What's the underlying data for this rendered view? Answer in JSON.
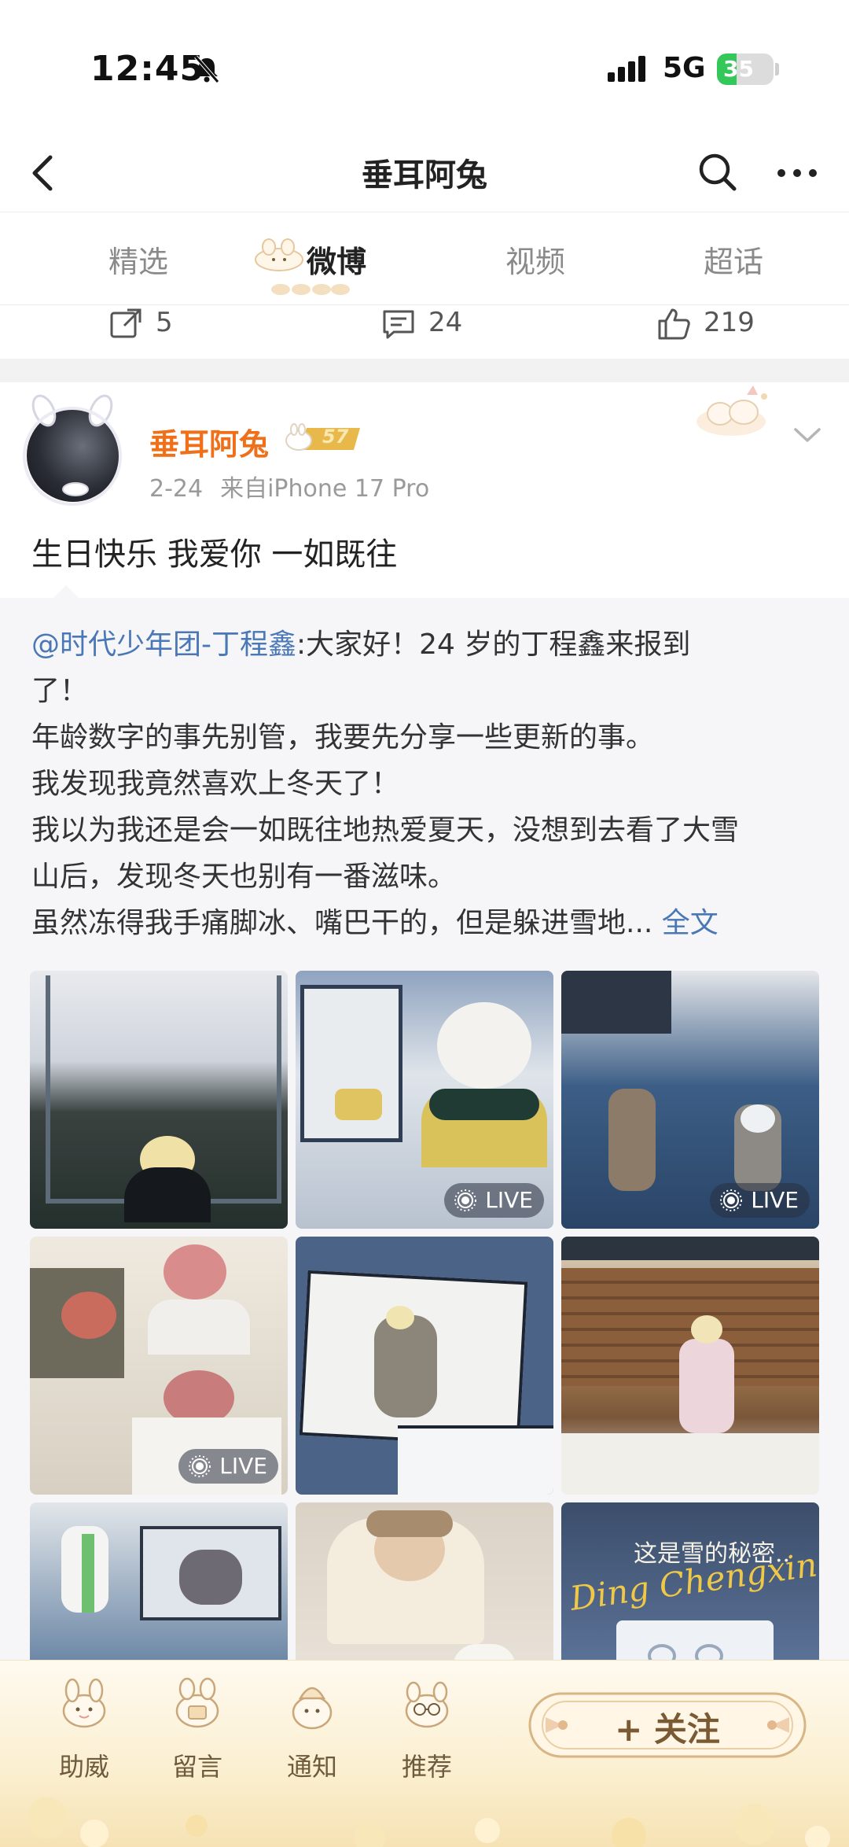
{
  "status_bar": {
    "time": "12:45",
    "network": "5G",
    "battery_level": "35",
    "battery_fraction": 0.35,
    "icons": [
      "bell-muted-icon",
      "signal-icon",
      "battery-icon"
    ]
  },
  "header": {
    "title": "垂耳阿兔",
    "icons": [
      "back-icon",
      "search-icon",
      "more-icon"
    ]
  },
  "tabs": [
    {
      "label": "精选",
      "active": false
    },
    {
      "label": "微博",
      "active": true
    },
    {
      "label": "视频",
      "active": false
    },
    {
      "label": "超话",
      "active": false
    }
  ],
  "prev_post_actions": {
    "reposts": "5",
    "comments": "24",
    "likes": "219"
  },
  "post": {
    "author": "垂耳阿兔",
    "level": "57",
    "date": "2-24",
    "source": "来自iPhone 17 Pro",
    "text": "生日快乐 我爱你 一如既往",
    "repost": {
      "mention": "@时代少年团-丁程鑫",
      "lines": [
        ":大家好！24 岁的丁程鑫来报到",
        "了！",
        "年龄数字的事先别管，我要先分享一些更新的事。",
        "我发现我竟然喜欢上冬天了！",
        "我以为我还是会一如既往地热爱夏天，没想到去看了大雪",
        "山后，发现冬天也别有一番滋味。",
        "虽然冻得我手痛脚冰、嘴巴干的，但是躲进雪地..."
      ],
      "full_text_link": "全文",
      "images": [
        {
          "live": false
        },
        {
          "live": true
        },
        {
          "live": true
        },
        {
          "live": true
        },
        {
          "live": false
        },
        {
          "live": false
        },
        {
          "live": false
        },
        {
          "live": false
        },
        {
          "live": false
        }
      ],
      "live_label": "LIVE",
      "tile_caption_top": "这是雪的秘密..",
      "tile_caption_script": "Ding Chengxin"
    }
  },
  "bottom_bar": {
    "items": [
      {
        "label": "助威",
        "icon": "cheer-icon"
      },
      {
        "label": "留言",
        "icon": "message-icon"
      },
      {
        "label": "通知",
        "icon": "notify-icon"
      },
      {
        "label": "推荐",
        "icon": "recommend-icon"
      }
    ],
    "follow_label": "+ 关注"
  },
  "colors": {
    "accent_orange": "#f0701a",
    "link_blue": "#4a77b6",
    "live_badge": "#283040",
    "battery_green": "#34c759"
  }
}
